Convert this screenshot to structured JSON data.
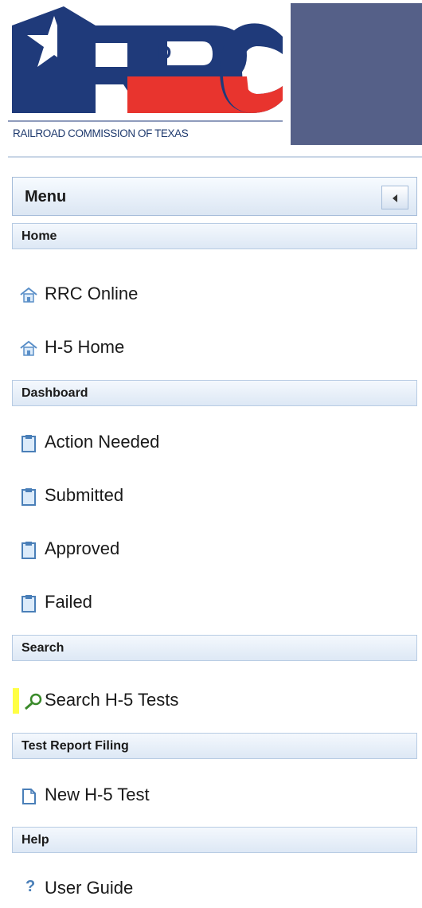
{
  "header": {
    "logo_letters": "RRC",
    "logo_d": "D",
    "logo_caption": "RAILROAD COMMISSION OF TEXAS",
    "band_color": "#556088"
  },
  "menu": {
    "title": "Menu",
    "collapse_icon": "chevron-left-icon"
  },
  "sections": {
    "home": {
      "label": "Home",
      "items": [
        {
          "label": "RRC Online",
          "icon": "home-icon"
        },
        {
          "label": "H-5 Home",
          "icon": "home-icon"
        }
      ]
    },
    "dashboard": {
      "label": "Dashboard",
      "items": [
        {
          "label": "Action Needed",
          "icon": "clipboard-icon"
        },
        {
          "label": "Submitted",
          "icon": "clipboard-icon"
        },
        {
          "label": "Approved",
          "icon": "clipboard-icon"
        },
        {
          "label": "Failed",
          "icon": "clipboard-icon"
        }
      ]
    },
    "search": {
      "label": "Search",
      "items": [
        {
          "label": "Search H-5 Tests",
          "icon": "search-icon",
          "highlighted": true
        }
      ]
    },
    "filing": {
      "label": "Test Report Filing",
      "items": [
        {
          "label": "New H-5 Test",
          "icon": "new-document-icon"
        }
      ]
    },
    "help": {
      "label": "Help",
      "items": [
        {
          "label": "User Guide",
          "icon": "question-icon"
        }
      ]
    }
  },
  "colors": {
    "logo_blue": "#1f3a7a",
    "logo_red": "#e8342e",
    "highlight": "#ffff44",
    "section_border": "#b7cbe3"
  }
}
